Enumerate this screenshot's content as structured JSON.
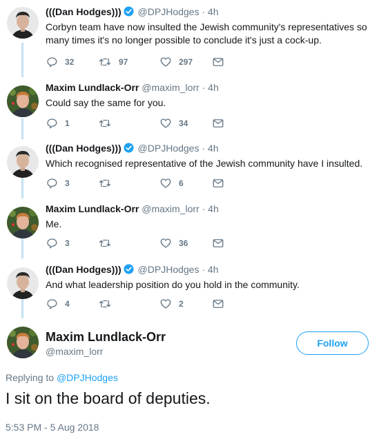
{
  "thread": [
    {
      "name": "(((Dan Hodges)))",
      "verified": true,
      "handle": "@DPJHodges",
      "dot": "·",
      "time": "4h",
      "text": "Corbyn team have now insulted the Jewish community's representatives so many times it's no longer possible to conclude it's just a cock-up.",
      "replies": "32",
      "retweets": "97",
      "likes": "297",
      "avatar": "dan-avatar"
    },
    {
      "name": "Maxim Lundlack-Orr",
      "verified": false,
      "handle": "@maxim_lorr",
      "dot": "·",
      "time": "4h",
      "text": "Could say the same for you.",
      "replies": "1",
      "retweets": "",
      "likes": "34",
      "avatar": "maxim-avatar"
    },
    {
      "name": "(((Dan Hodges)))",
      "verified": true,
      "handle": "@DPJHodges",
      "dot": "·",
      "time": "4h",
      "text": "Which recognised representative of the Jewish community have I insulted.",
      "replies": "3",
      "retweets": "",
      "likes": "6",
      "avatar": "dan-avatar"
    },
    {
      "name": "Maxim Lundlack-Orr",
      "verified": false,
      "handle": "@maxim_lorr",
      "dot": "·",
      "time": "4h",
      "text": "Me.",
      "replies": "3",
      "retweets": "",
      "likes": "36",
      "avatar": "maxim-avatar"
    },
    {
      "name": "(((Dan Hodges)))",
      "verified": true,
      "handle": "@DPJHodges",
      "dot": "·",
      "time": "4h",
      "text": "And what leadership position do you hold in the community.",
      "replies": "4",
      "retweets": "",
      "likes": "2",
      "avatar": "dan-avatar"
    }
  ],
  "main": {
    "name": "Maxim Lundlack-Orr",
    "handle": "@maxim_lorr",
    "follow_label": "Follow",
    "replying_prefix": "Replying to",
    "replying_to": "@DPJHodges",
    "text": "I sit on the board of deputies.",
    "timestamp": "5:53 PM - 5 Aug 2018"
  },
  "icons": {
    "reply": "reply-icon",
    "retweet": "retweet-icon",
    "like": "heart-icon",
    "dm": "envelope-icon",
    "verified": "verified-badge-icon"
  },
  "colors": {
    "accent": "#1da1f2",
    "muted": "#657786",
    "thread_line": "#c4e1f2"
  }
}
